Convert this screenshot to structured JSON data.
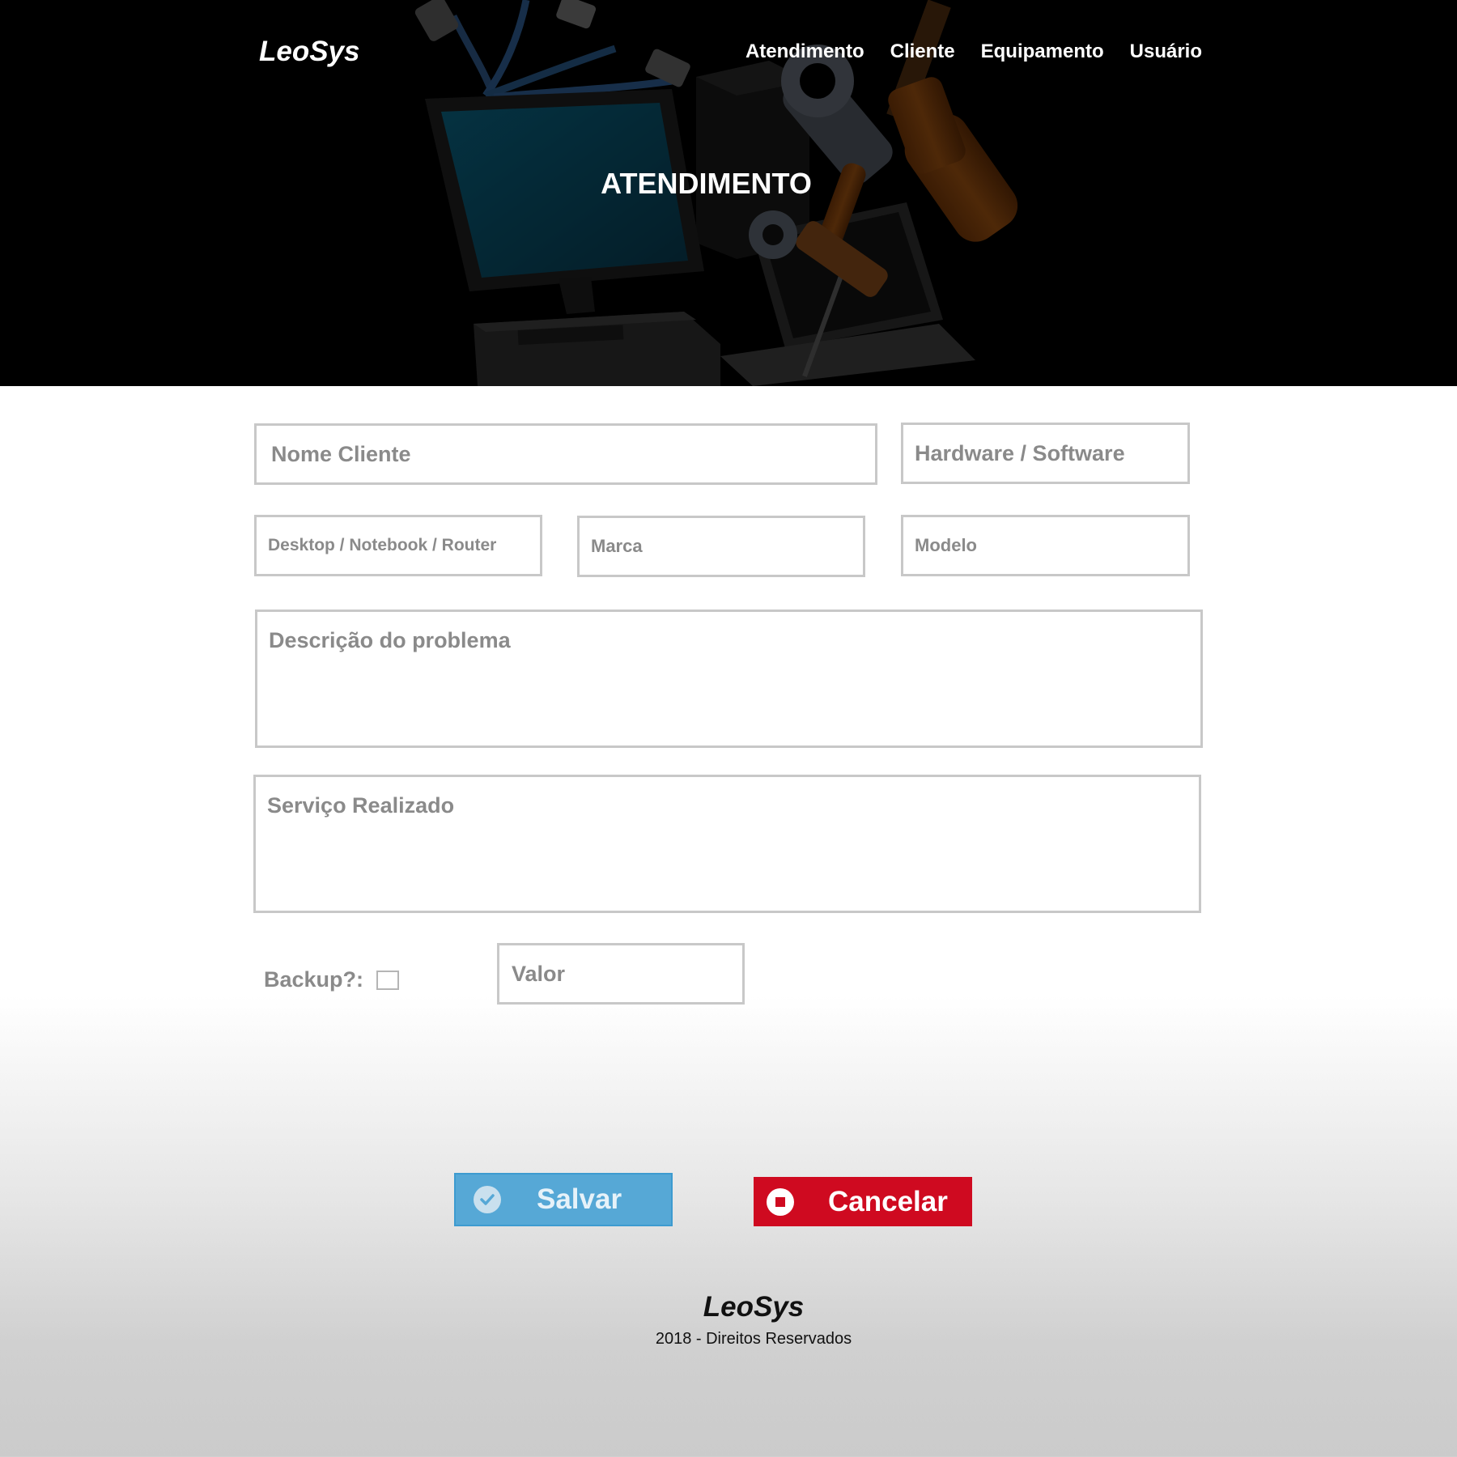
{
  "header": {
    "brand": "LeoSys",
    "nav": [
      "Atendimento",
      "Cliente",
      "Equipamento",
      "Usuário"
    ],
    "hero_title": "ATENDIMENTO"
  },
  "form": {
    "nome_cliente": {
      "placeholder": "Nome Cliente",
      "value": ""
    },
    "tipo": {
      "placeholder": "Hardware / Software",
      "value": ""
    },
    "equipamento": {
      "placeholder": "Desktop / Notebook / Router",
      "value": ""
    },
    "marca": {
      "placeholder": "Marca",
      "value": ""
    },
    "modelo": {
      "placeholder": "Modelo",
      "value": ""
    },
    "descricao": {
      "placeholder": "Descrição do problema",
      "value": ""
    },
    "servico": {
      "placeholder": "Serviço Realizado",
      "value": ""
    },
    "backup_label": "Backup?:",
    "backup_checked": false,
    "valor": {
      "placeholder": "Valor",
      "value": ""
    }
  },
  "actions": {
    "save_label": "Salvar",
    "cancel_label": "Cancelar",
    "save_color": "#56a8d6",
    "cancel_color": "#cf0a20",
    "save_icon": "check-circle-icon",
    "cancel_icon": "stop-circle-icon"
  },
  "footer": {
    "brand": "LeoSys",
    "copyright": "2018 - Direitos Reservados"
  }
}
